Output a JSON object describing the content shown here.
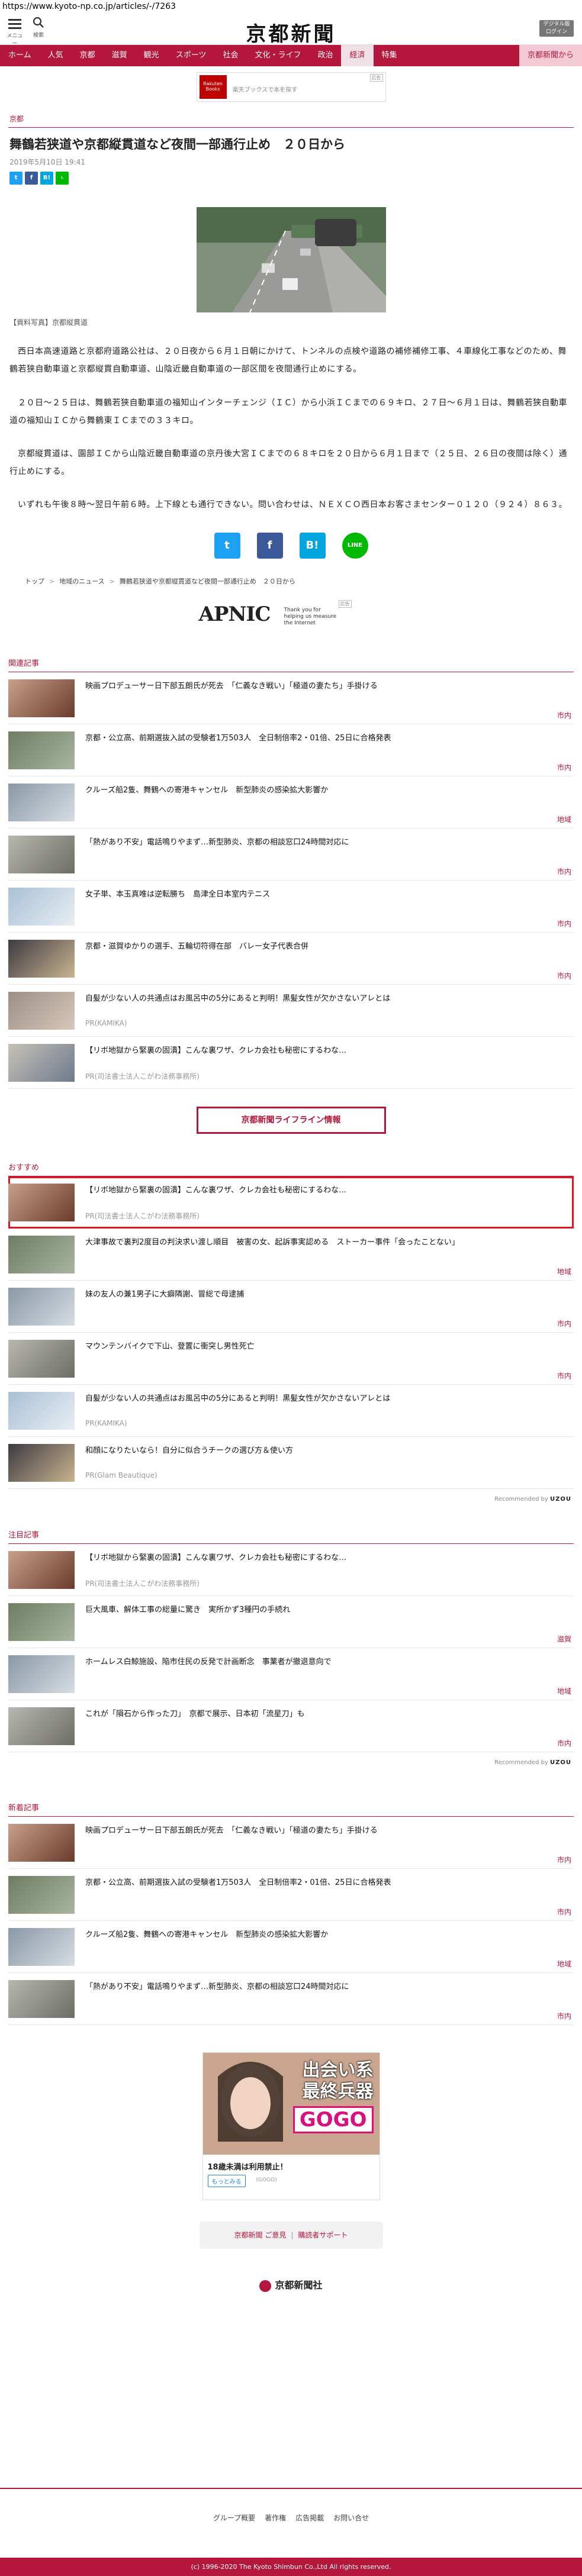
{
  "url": "https://www.kyoto-np.co.jp/articles/-/7263",
  "header": {
    "menu_caption": "メニュー",
    "search_caption": "検索",
    "logo": "京都新聞",
    "digital_label_1": "デジタル版",
    "digital_label_2": "ログイン"
  },
  "nav": [
    "ホーム",
    "人気",
    "京都",
    "滋賀",
    "観光",
    "スポーツ",
    "社会",
    "文化・ライフ",
    "政治",
    "経済",
    "特集",
    "京都新聞から"
  ],
  "ad_top": {
    "brand": "Rakuten Books",
    "text": "楽天ブックスで本を探す",
    "tag": "広告"
  },
  "article": {
    "category": "京都",
    "title": "舞鶴若狭道や京都縦貫道など夜間一部通行止め　２０日から",
    "date": "2019年5月10日 19:41",
    "caption": "【資料写真】京都縦貫道",
    "paragraphs": [
      "西日本高速道路と京都府道路公社は、２０日夜から６月１日朝にかけて、トンネルの点検や道路の補修補修工事、４車線化工事などのため、舞鶴若狭自動車道と京都縦貫自動車道、山陰近畿自動車道の一部区間を夜間通行止めにする。",
      "２０日〜２５日は、舞鶴若狭自動車道の福知山インターチェンジ（ＩＣ）から小浜ＩＣまでの６９キロ、２７日〜６月１日は、舞鶴若狭自動車道の福知山ＩＣから舞鶴東ＩＣまでの３３キロ。",
      "京都縦貫道は、園部ＩＣから山陰近畿自動車道の京丹後大宮ＩＣまでの６８キロを２０日から６月１日まで（２５日、２６日の夜間は除く）通行止めにする。",
      "いずれも午後８時〜翌日午前６時。上下線とも通行できない。問い合わせは、ＮＥＸＣＯ西日本お客さまセンター０１２０（９２４）８６３。"
    ]
  },
  "share": {
    "tw": "t",
    "fb": "f",
    "hb": "B!",
    "ln": "LINE"
  },
  "breadcrumb": [
    "トップ",
    "地域のニュース",
    "舞鶴若狭道や京都縦貫道など夜間一部通行止め　２０日から"
  ],
  "ad_apnic": {
    "brand": "APNIC",
    "sub": "Thank you for helping us measure the Internet",
    "tag": "広告"
  },
  "related": {
    "heading": "関連記事",
    "items": [
      {
        "title": "映画プロデューサー日下部五朗氏が死去　「仁義なき戦い」「極道の妻たち」手掛ける",
        "pr": "",
        "cat": "市内"
      },
      {
        "title": "京都・公立高、前期選抜入試の受験者1万503人　全日制倍率2・01倍、25日に合格発表",
        "pr": "",
        "cat": "市内"
      },
      {
        "title": "クルーズ船2隻、舞鶴への寄港キャンセル　新型肺炎の感染拡大影響か",
        "pr": "",
        "cat": "地域"
      },
      {
        "title": "「熱があり不安」電話鳴りやまず…新型肺炎、京都の相談窓口24時間対応に",
        "pr": "",
        "cat": "市内"
      },
      {
        "title": "女子単、本玉真唯は逆転勝ち　島津全日本室内テニス",
        "pr": "",
        "cat": "市内"
      },
      {
        "title": "京都・滋賀ゆかりの選手、五輪切符得在部　バレー女子代表合併",
        "pr": "",
        "cat": "市内"
      },
      {
        "title": "自髪が少ない人の共通点はお風呂中の5分にあると判明！黒髪女性が欠かさないアレとは",
        "pr": "PR(KAMIKA)",
        "cat": ""
      },
      {
        "title": "【リボ地獄から緊裏の固潰】こんな裏ワザ、クレカ会社も秘密にするわな…",
        "pr": "PR(司法書士法人こがわ法務事務所)",
        "cat": ""
      }
    ]
  },
  "lifeline": "京都新聞ライフライン情報",
  "recommend": {
    "heading": "おすすめ",
    "items": [
      {
        "title": "【リボ地獄から緊裏の固潰】こんな裏ワザ、クレカ会社も秘密にするわな…",
        "pr": "PR(司法書士法人こがわ法務事務所)",
        "cat": ""
      },
      {
        "title": "大津事故で裏判2度目の判決求い渡し順目　被害の女、起訴事実認める　ストーカー事件「会ったことない」",
        "pr": "",
        "cat": "地域"
      },
      {
        "title": "妹の友人の兼1男子に大癖隣謝、冒総で母逮捕",
        "pr": "",
        "cat": "市内"
      },
      {
        "title": "マウンテンバイクで下山、登置に衝突し男性死亡",
        "pr": "",
        "cat": "市内"
      },
      {
        "title": "自髪が少ない人の共通点はお風呂中の5分にあると判明！黒髪女性が欠かさないアレとは",
        "pr": "PR(KAMIKA)",
        "cat": ""
      },
      {
        "title": "和顔になりたいなら！自分に似合うチークの選び方＆使い方",
        "pr": "PR(Glam Beautique)",
        "cat": ""
      }
    ],
    "recommended_by": "Recommended by",
    "uzou": "UZOU"
  },
  "attention": {
    "heading": "注目記事",
    "items": [
      {
        "title": "【リボ地獄から緊裏の固潰】こんな裏ワザ、クレカ会社も秘密にするわな…",
        "pr": "PR(司法書士法人こがわ法務事務所)",
        "cat": ""
      },
      {
        "title": "巨大風車、解体工事の総量に驚き　実所かず3種円の手続れ",
        "pr": "",
        "cat": "滋賀"
      },
      {
        "title": "ホームレス白鯨施設、陥市住民の反発で計画断念　事業者が撤退意向で",
        "pr": "",
        "cat": "地域"
      },
      {
        "title": "これが「隕石から作った刀」　京都で展示、日本初「流星刀」も",
        "pr": "",
        "cat": "市内"
      }
    ],
    "recommended_by": "Recommended by",
    "uzou": "UZOU"
  },
  "latest": {
    "heading": "新着記事",
    "items": [
      {
        "title": "映画プロデューサー日下部五朗氏が死去　「仁義なき戦い」「極道の妻たち」手掛ける",
        "pr": "",
        "cat": "市内"
      },
      {
        "title": "京都・公立高、前期選抜入試の受験者1万503人　全日制倍率2・01倍、25日に合格発表",
        "pr": "",
        "cat": "市内"
      },
      {
        "title": "クルーズ船2隻、舞鶴への寄港キャンセル　新型肺炎の感染拡大影響か",
        "pr": "",
        "cat": "地域"
      },
      {
        "title": "「熱があり不安」電話鳴りやまず…新型肺炎、京都の相談窓口24時間対応に",
        "pr": "",
        "cat": "市内"
      }
    ]
  },
  "ad_bottom": {
    "headline_1": "出会い系",
    "headline_2": "最終兵器",
    "brand": "GOGO",
    "footer": "18歳未満は利用禁止！",
    "more": "もっとみる",
    "src": "(GOGO)"
  },
  "footer": {
    "links": [
      "京都新聞 ご意見",
      "購読者サポート"
    ],
    "logo": "京都新聞社",
    "nav": [
      "グループ概要",
      "著作権",
      "広告掲載",
      "お問い合せ"
    ],
    "copyright": "(c) 1996-2020 The Kyoto Shimbun Co.,Ltd All rights reserved."
  }
}
